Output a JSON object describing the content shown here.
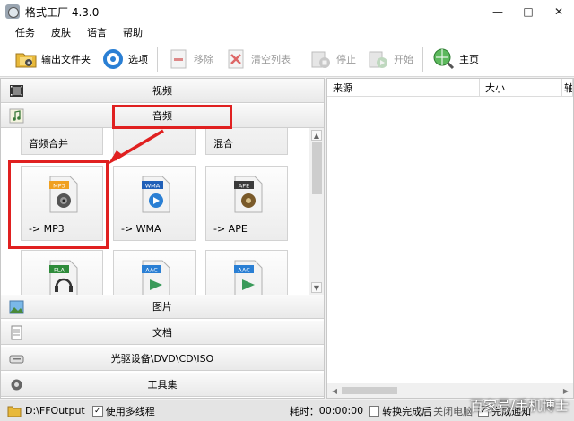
{
  "window": {
    "title": "格式工厂 4.3.0",
    "minimize": "—",
    "maximize": "□",
    "close": "✕"
  },
  "menu": [
    "任务",
    "皮肤",
    "语言",
    "帮助"
  ],
  "toolbar": {
    "output_folder": "输出文件夹",
    "options": "选项",
    "remove": "移除",
    "clear_list": "清空列表",
    "stop": "停止",
    "start": "开始",
    "home": "主页"
  },
  "categories": {
    "video": "视频",
    "audio": "音频",
    "image": "图片",
    "document": "文档",
    "disc": "光驱设备\\DVD\\CD\\ISO",
    "toolbox": "工具集"
  },
  "tiles": {
    "top_row": [
      "音频合并",
      "",
      "混合"
    ],
    "mp3": {
      "badge": "MP3",
      "label": "-> MP3"
    },
    "wma": {
      "badge": "WMA",
      "label": "-> WMA"
    },
    "ape": {
      "badge": "APE",
      "label": "-> APE"
    },
    "bottom_row": [
      "FLA",
      "AAC",
      "AAC"
    ]
  },
  "file_list": {
    "columns": [
      "来源",
      "大小",
      "轴"
    ]
  },
  "status": {
    "output_path": "D:\\FFOutput",
    "multithread": "使用多线程",
    "multithread_checked": "✓",
    "elapsed_label": "耗时：",
    "elapsed": "00:00:00",
    "after_done": "转换完成后",
    "after_done_suffix": "关闭电脑",
    "notify": "完成通知",
    "notify_checked": "✓"
  },
  "watermark": "百家号/手机博士",
  "colors": {
    "highlight": "#e02020",
    "accent_blue": "#2a7fd4"
  }
}
